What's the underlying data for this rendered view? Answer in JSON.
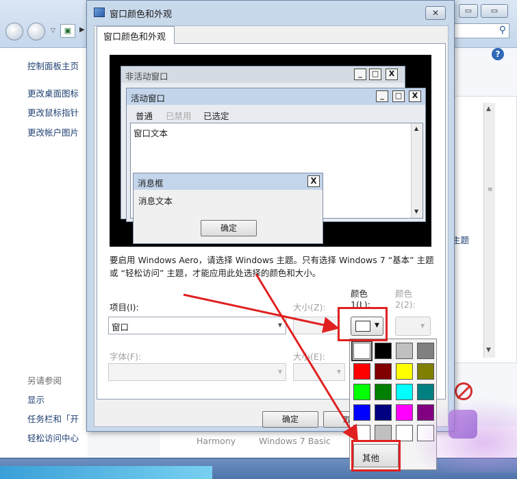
{
  "background_window": {
    "sidebar": {
      "links": [
        "控制面板主页",
        "更改桌面图标",
        "更改鼠标指针",
        "更改帐户图片"
      ],
      "see_also_header": "另请参阅",
      "see_also_links": [
        "显示",
        "任务栏和「开",
        "轻松访问中心"
      ]
    },
    "theme_link": "主题",
    "theme_names": [
      "Harmony",
      "Windows 7 Basic"
    ],
    "buttons": {
      "minimize": "▭",
      "maximize": "▭",
      "close": "✕"
    }
  },
  "dialog": {
    "title": "窗口颜色和外观",
    "close_label": "✕",
    "tab_label": "窗口颜色和外观",
    "preview": {
      "inactive_title": "非活动窗口",
      "active_title": "活动窗口",
      "menu": {
        "normal": "普通",
        "disabled": "已禁用",
        "selected": "已选定"
      },
      "window_text": "窗口文本",
      "msgbox_title": "消息框",
      "msgbox_text": "消息文本",
      "msgbox_ok": "确定",
      "caption_buttons": [
        "_",
        "□",
        "X"
      ]
    },
    "description": "要启用 Windows Aero，请选择 Windows 主题。只有选择 Windows 7 “基本” 主题或 “轻松访问” 主题，才能应用此处选择的颜色和大小。",
    "item_label": "项目(I):",
    "item_value": "窗口",
    "size_label": "大小(Z):",
    "color1_label_line1": "颜色",
    "color1_label_line2": "1(L):",
    "color2_label_line1": "颜色",
    "color2_label_line2": "2(2):",
    "font_label": "字体(F):",
    "font_size_label": "大小(E):",
    "ok_label": "确定",
    "cancel_partial": "取",
    "other_label": "其他",
    "color1_value": "#ffffff",
    "palette": [
      "#ffffff",
      "#000000",
      "#c0c0c0",
      "#808080",
      "#ff0000",
      "#800000",
      "#ffff00",
      "#808000",
      "#00ff00",
      "#008000",
      "#00ffff",
      "#008080",
      "#0000ff",
      "#000080",
      "#ff00ff",
      "#800080",
      "#ffffff",
      "#c0c0c0",
      "#ffffff",
      "#ffffff"
    ]
  },
  "annotation_color": "#e02020"
}
